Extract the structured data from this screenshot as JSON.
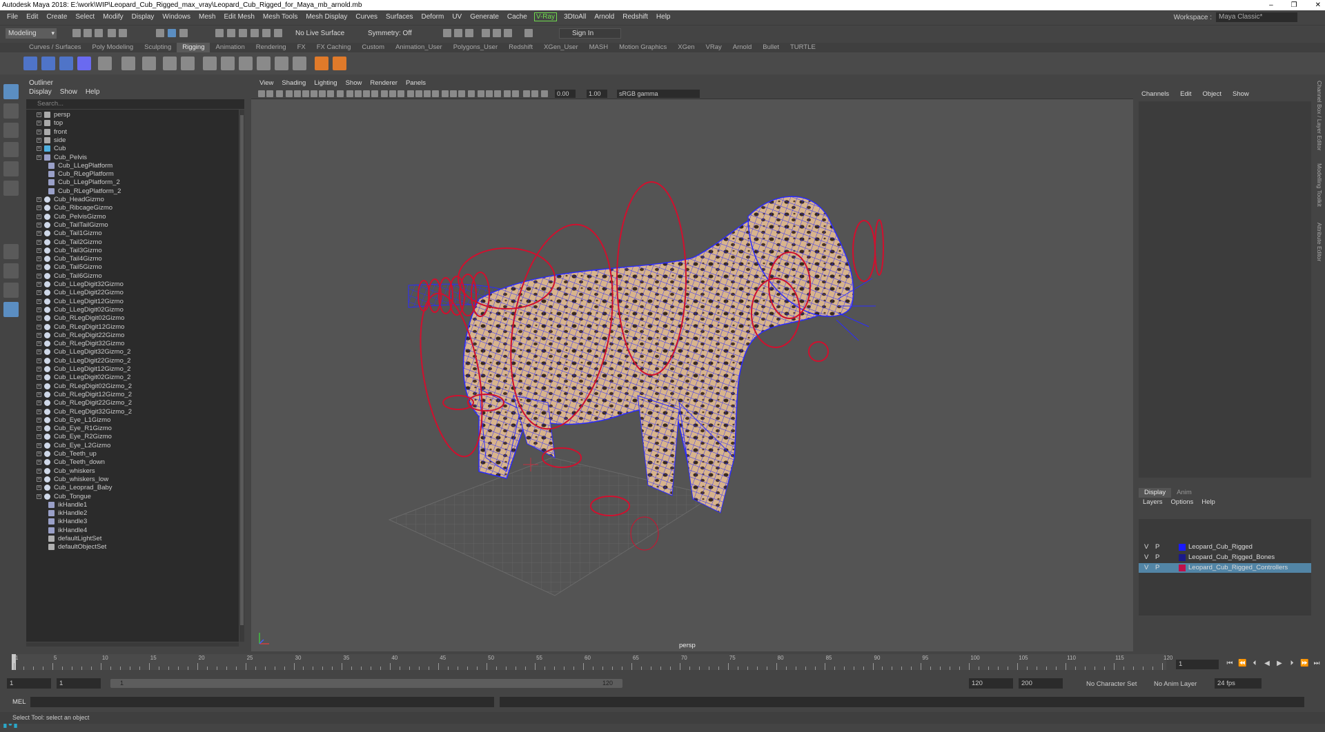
{
  "window": {
    "title": "Autodesk Maya 2018: E:\\work\\WIP\\Leopard_Cub_Rigged_max_vray\\Leopard_Cub_Rigged_for_Maya_mb_arnold.mb",
    "controls": [
      "–",
      "❐",
      "✕"
    ]
  },
  "menubar": {
    "items": [
      "File",
      "Edit",
      "Create",
      "Select",
      "Modify",
      "Display",
      "Windows",
      "Mesh",
      "Edit Mesh",
      "Mesh Tools",
      "Mesh Display",
      "Curves",
      "Surfaces",
      "Deform",
      "UV",
      "Generate",
      "Cache"
    ],
    "vray": "V-Ray",
    "items2": [
      "3DtoAll",
      "Arnold",
      "Redshift",
      "Help"
    ],
    "workspace_label": "Workspace :",
    "workspace_value": "Maya Classic*"
  },
  "statusline": {
    "mode": "Modeling",
    "symmetry": "Symmetry: Off",
    "live_surface": "No Live Surface",
    "sign_in": "Sign In"
  },
  "shelf": {
    "tabs": [
      "Curves / Surfaces",
      "Poly Modeling",
      "Sculpting",
      "Rigging",
      "Animation",
      "Rendering",
      "FX",
      "FX Caching",
      "Custom",
      "Animation_User",
      "Polygons_User",
      "Redshift",
      "XGen_User",
      "MASH",
      "Motion Graphics",
      "XGen",
      "VRay",
      "Arnold",
      "Bullet",
      "TURTLE"
    ],
    "active_tab": "Rigging"
  },
  "outliner": {
    "title": "Outliner",
    "menu": [
      "Display",
      "Show",
      "Help"
    ],
    "search_placeholder": "Search...",
    "items": [
      {
        "name": "persp",
        "icon": "camera",
        "expand": true
      },
      {
        "name": "top",
        "icon": "camera",
        "expand": true
      },
      {
        "name": "front",
        "icon": "camera",
        "expand": true
      },
      {
        "name": "side",
        "icon": "camera",
        "expand": true
      },
      {
        "name": "Cub",
        "icon": "joint",
        "expand": true
      },
      {
        "name": "Cub_Pelvis",
        "icon": "ik",
        "expand": true
      },
      {
        "name": "Cub_LLegPlatform",
        "icon": "ik",
        "expand": false
      },
      {
        "name": "Cub_RLegPlatform",
        "icon": "ik",
        "expand": false
      },
      {
        "name": "Cub_LLegPlatform_2",
        "icon": "ik",
        "expand": false
      },
      {
        "name": "Cub_RLegPlatform_2",
        "icon": "ik",
        "expand": false
      },
      {
        "name": "Cub_HeadGizmo",
        "icon": "gizmo",
        "expand": true
      },
      {
        "name": "Cub_RibcageGizmo",
        "icon": "gizmo",
        "expand": true
      },
      {
        "name": "Cub_PelvisGizmo",
        "icon": "gizmo",
        "expand": true
      },
      {
        "name": "Cub_TailTailGizmo",
        "icon": "gizmo",
        "expand": true
      },
      {
        "name": "Cub_Tail1Gizmo",
        "icon": "gizmo",
        "expand": true
      },
      {
        "name": "Cub_Tail2Gizmo",
        "icon": "gizmo",
        "expand": true
      },
      {
        "name": "Cub_Tail3Gizmo",
        "icon": "gizmo",
        "expand": true
      },
      {
        "name": "Cub_Tail4Gizmo",
        "icon": "gizmo",
        "expand": true
      },
      {
        "name": "Cub_Tail5Gizmo",
        "icon": "gizmo",
        "expand": true
      },
      {
        "name": "Cub_Tail6Gizmo",
        "icon": "gizmo",
        "expand": true
      },
      {
        "name": "Cub_LLegDigit32Gizmo",
        "icon": "gizmo",
        "expand": true
      },
      {
        "name": "Cub_LLegDigit22Gizmo",
        "icon": "gizmo",
        "expand": true
      },
      {
        "name": "Cub_LLegDigit12Gizmo",
        "icon": "gizmo",
        "expand": true
      },
      {
        "name": "Cub_LLegDigit02Gizmo",
        "icon": "gizmo",
        "expand": true
      },
      {
        "name": "Cub_RLegDigit02Gizmo",
        "icon": "gizmo",
        "expand": true
      },
      {
        "name": "Cub_RLegDigit12Gizmo",
        "icon": "gizmo",
        "expand": true
      },
      {
        "name": "Cub_RLegDigit22Gizmo",
        "icon": "gizmo",
        "expand": true
      },
      {
        "name": "Cub_RLegDigit32Gizmo",
        "icon": "gizmo",
        "expand": true
      },
      {
        "name": "Cub_LLegDigit32Gizmo_2",
        "icon": "gizmo",
        "expand": true
      },
      {
        "name": "Cub_LLegDigit22Gizmo_2",
        "icon": "gizmo",
        "expand": true
      },
      {
        "name": "Cub_LLegDigit12Gizmo_2",
        "icon": "gizmo",
        "expand": true
      },
      {
        "name": "Cub_LLegDigit02Gizmo_2",
        "icon": "gizmo",
        "expand": true
      },
      {
        "name": "Cub_RLegDigit02Gizmo_2",
        "icon": "gizmo",
        "expand": true
      },
      {
        "name": "Cub_RLegDigit12Gizmo_2",
        "icon": "gizmo",
        "expand": true
      },
      {
        "name": "Cub_RLegDigit22Gizmo_2",
        "icon": "gizmo",
        "expand": true
      },
      {
        "name": "Cub_RLegDigit32Gizmo_2",
        "icon": "gizmo",
        "expand": true
      },
      {
        "name": "Cub_Eye_L1Gizmo",
        "icon": "gizmo",
        "expand": true
      },
      {
        "name": "Cub_Eye_R1Gizmo",
        "icon": "gizmo",
        "expand": true
      },
      {
        "name": "Cub_Eye_R2Gizmo",
        "icon": "gizmo",
        "expand": true
      },
      {
        "name": "Cub_Eye_L2Gizmo",
        "icon": "gizmo",
        "expand": true
      },
      {
        "name": "Cub_Teeth_up",
        "icon": "gizmo",
        "expand": true
      },
      {
        "name": "Cub_Teeth_down",
        "icon": "gizmo",
        "expand": true
      },
      {
        "name": "Cub_whiskers",
        "icon": "gizmo",
        "expand": true
      },
      {
        "name": "Cub_whiskers_low",
        "icon": "gizmo",
        "expand": true
      },
      {
        "name": "Cub_Leoprad_Baby",
        "icon": "gizmo",
        "expand": true
      },
      {
        "name": "Cub_Tongue",
        "icon": "gizmo",
        "expand": true
      },
      {
        "name": "ikHandle1",
        "icon": "ik",
        "expand": false
      },
      {
        "name": "ikHandle2",
        "icon": "ik",
        "expand": false
      },
      {
        "name": "ikHandle3",
        "icon": "ik",
        "expand": false
      },
      {
        "name": "ikHandle4",
        "icon": "ik",
        "expand": false
      },
      {
        "name": "defaultLightSet",
        "icon": "set",
        "expand": false
      },
      {
        "name": "defaultObjectSet",
        "icon": "set",
        "expand": false
      }
    ]
  },
  "viewport": {
    "menu": [
      "View",
      "Shading",
      "Lighting",
      "Show",
      "Renderer",
      "Panels"
    ],
    "exposure": "0.00",
    "gamma": "1.00",
    "color_space": "sRGB gamma",
    "camera_label": "persp"
  },
  "channelbox": {
    "menu": [
      "Channels",
      "Edit",
      "Object",
      "Show"
    ],
    "tabs": [
      "Display",
      "Anim"
    ],
    "active_tab": "Display",
    "layer_menu": [
      "Layers",
      "Options",
      "Help"
    ],
    "layers": [
      {
        "v": "V",
        "p": "P",
        "name": "Leopard_Cub_Rigged",
        "color": "#1a1aff",
        "selected": false
      },
      {
        "v": "V",
        "p": "P",
        "name": "Leopard_Cub_Rigged_Bones",
        "color": "#1a1a8a",
        "selected": false
      },
      {
        "v": "V",
        "p": "P",
        "name": "Leopard_Cub_Rigged_Controllers",
        "color": "#c0104a",
        "selected": true
      }
    ],
    "side_tabs": [
      "Channel Box / Layer Editor",
      "Modelling Toolkit",
      "Attribute Editor"
    ]
  },
  "timeline": {
    "ticks": [
      1,
      5,
      10,
      15,
      20,
      25,
      30,
      35,
      40,
      45,
      50,
      55,
      60,
      65,
      70,
      75,
      80,
      85,
      90,
      95,
      100,
      105,
      110,
      115,
      120
    ],
    "current_frame": "1",
    "range_start": "1",
    "range_start2": "1",
    "slider_start": "1",
    "slider_end": "120",
    "end_time": "120",
    "end_time2": "200",
    "character_set": "No Character Set",
    "anim_layer": "No Anim Layer",
    "fps": "24 fps"
  },
  "command": {
    "mel_label": "MEL",
    "help_text": "Select Tool: select an object"
  },
  "colors": {
    "wire_blue": "#2b2bff",
    "controller_red": "#d0102e",
    "selection_blue": "#5285a6",
    "vray_green": "#6fdc4e"
  }
}
